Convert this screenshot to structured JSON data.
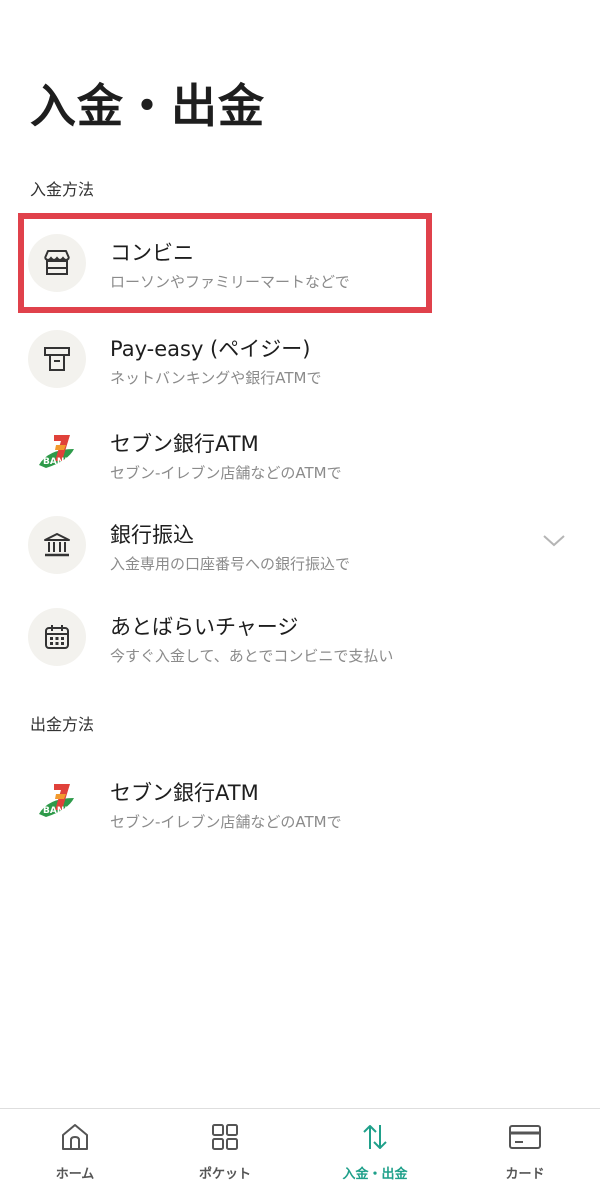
{
  "header": {
    "title": "入金・出金"
  },
  "deposit": {
    "section_label": "入金方法",
    "items": [
      {
        "title": "コンビニ",
        "subtitle": "ローソンやファミリーマートなどで",
        "icon": "store-icon"
      },
      {
        "title": "Pay-easy (ペイジー)",
        "subtitle": "ネットバンキングや銀行ATMで",
        "icon": "atm-icon"
      },
      {
        "title": "セブン銀行ATM",
        "subtitle": "セブン-イレブン店舗などのATMで",
        "icon": "seven-bank-logo",
        "logo_text": "BANK"
      },
      {
        "title": "銀行振込",
        "subtitle": "入金専用の口座番号への銀行振込で",
        "icon": "bank-icon"
      },
      {
        "title": "あとばらいチャージ",
        "subtitle": "今すぐ入金して、あとでコンビニで支払い",
        "icon": "calendar-icon"
      }
    ]
  },
  "withdraw": {
    "section_label": "出金方法",
    "items": [
      {
        "title": "セブン銀行ATM",
        "subtitle": "セブン-イレブン店舗などのATMで",
        "icon": "seven-bank-logo",
        "logo_text": "BANK"
      }
    ]
  },
  "tabbar": {
    "tabs": [
      {
        "label": "ホーム",
        "icon": "home-icon",
        "active": false
      },
      {
        "label": "ポケット",
        "icon": "grid-icon",
        "active": false
      },
      {
        "label": "入金・出金",
        "icon": "transfer-arrows-icon",
        "active": true
      },
      {
        "label": "カード",
        "icon": "card-icon",
        "active": false
      }
    ]
  },
  "colors": {
    "accent": "#1fa08a",
    "highlight_border": "#e0414b",
    "icon_bg": "#f3f2ee"
  }
}
